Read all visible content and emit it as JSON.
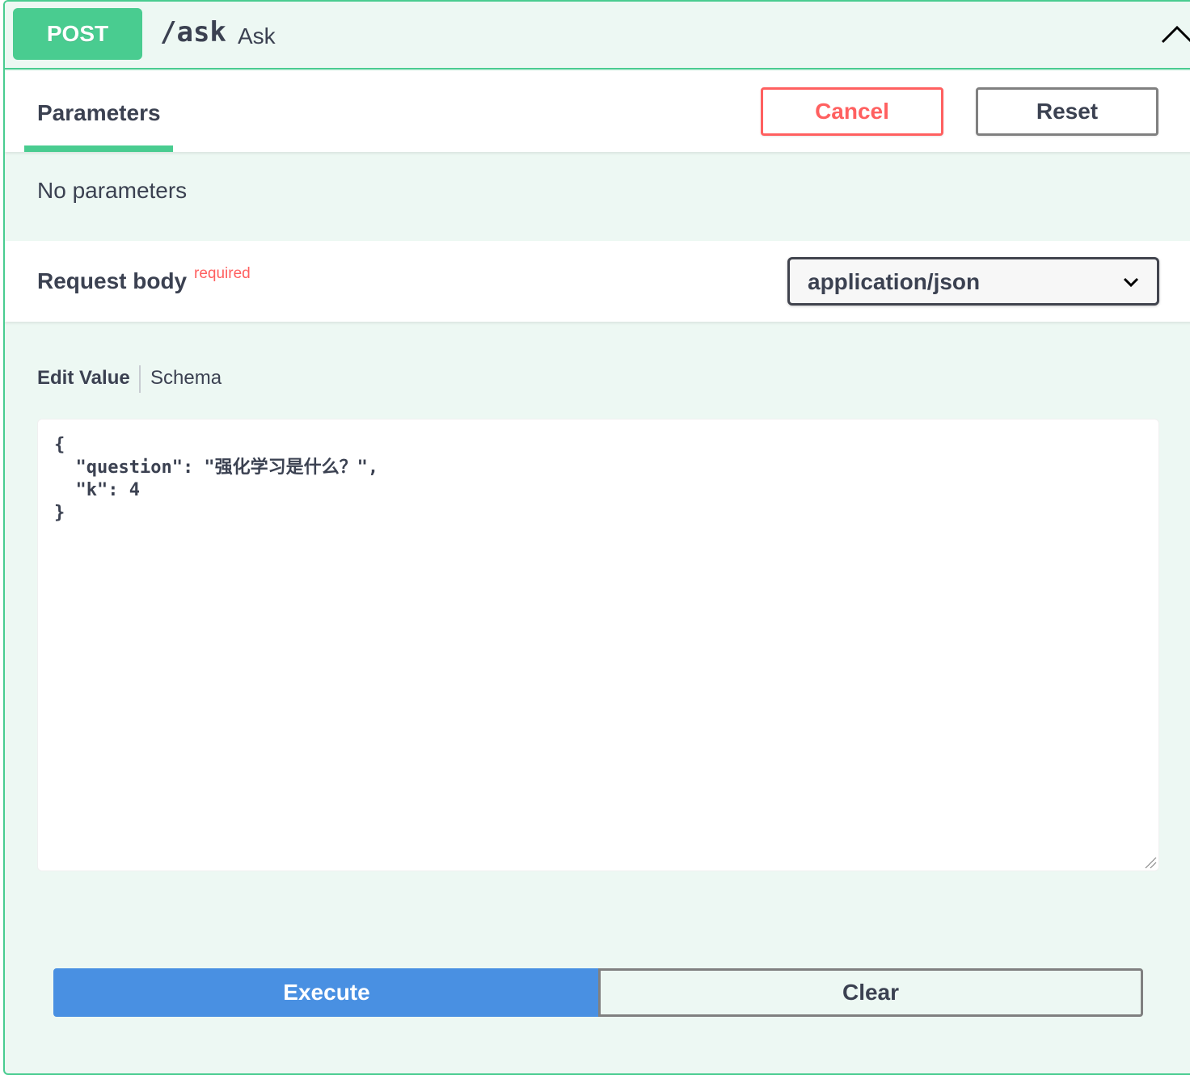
{
  "summary": {
    "method": "POST",
    "path": "/ask",
    "description": "Ask"
  },
  "parameters": {
    "tab_label": "Parameters",
    "cancel_label": "Cancel",
    "reset_label": "Reset",
    "empty_text": "No parameters"
  },
  "request_body": {
    "title": "Request body",
    "required_label": "required",
    "content_type": "application/json",
    "tabs": {
      "edit_value": "Edit Value",
      "schema": "Schema"
    },
    "body_value": "{\n  \"question\": \"强化学习是什么？\",\n  \"k\": 4\n}"
  },
  "actions": {
    "execute_label": "Execute",
    "clear_label": "Clear"
  },
  "colors": {
    "post_green": "#49cc90",
    "post_bg": "#edf8f3",
    "cancel_red": "#ff6060",
    "execute_blue": "#4990e2",
    "text_dark": "#3b4151"
  },
  "icons": {
    "collapse": "chevron-up-icon",
    "select": "chevron-down-icon",
    "resize": "resize-handle-icon"
  }
}
